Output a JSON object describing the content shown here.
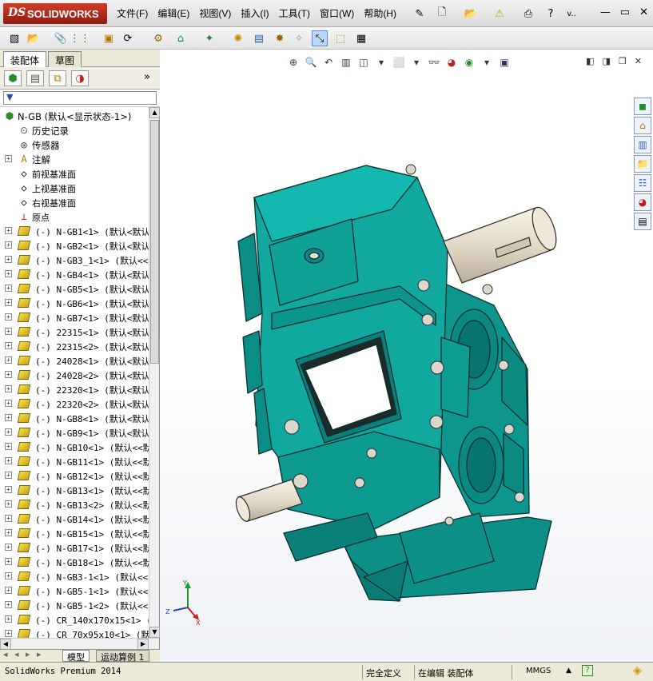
{
  "titlebar": {
    "logo_ds": "DS",
    "logo_text": "SOLIDWORKS",
    "menus": [
      "文件(F)",
      "编辑(E)",
      "视图(V)",
      "插入(I)",
      "工具(T)",
      "窗口(W)",
      "帮助(H)"
    ],
    "help_search_text": "v..",
    "window_controls": {
      "minimize": "—",
      "restore": "▭",
      "close": "✕"
    }
  },
  "panel": {
    "tabs": [
      "装配体",
      "草图"
    ],
    "more": "»",
    "tree": [
      {
        "label": "N-GB  (默认<显示状态-1>)",
        "kind": "root",
        "expand": ""
      },
      {
        "label": "历史记录",
        "kind": "feat",
        "icon": "history",
        "expand": ""
      },
      {
        "label": "传感器",
        "kind": "feat",
        "icon": "sensor",
        "expand": ""
      },
      {
        "label": "注解",
        "kind": "feat",
        "icon": "annotation",
        "expand": "+"
      },
      {
        "label": "前视基准面",
        "kind": "plane",
        "icon": "plane",
        "expand": ""
      },
      {
        "label": "上视基准面",
        "kind": "plane",
        "icon": "plane",
        "expand": ""
      },
      {
        "label": "右视基准面",
        "kind": "plane",
        "icon": "plane",
        "expand": ""
      },
      {
        "label": "原点",
        "kind": "origin",
        "icon": "origin",
        "expand": ""
      },
      {
        "label": "(-) N-GB1<1> (默认<默认",
        "kind": "part",
        "expand": "+"
      },
      {
        "label": "(-) N-GB2<1> (默认<默认",
        "kind": "part",
        "expand": "+"
      },
      {
        "label": "(-) N-GB3_1<1> (默认<<默",
        "kind": "part",
        "expand": "+"
      },
      {
        "label": "(-) N-GB4<1> (默认<默认",
        "kind": "part",
        "expand": "+"
      },
      {
        "label": "(-) N-GB5<1> (默认<默认",
        "kind": "part",
        "expand": "+"
      },
      {
        "label": "(-) N-GB6<1> (默认<默认",
        "kind": "part",
        "expand": "+"
      },
      {
        "label": "(-) N-GB7<1> (默认<默认",
        "kind": "part",
        "expand": "+"
      },
      {
        "label": "(-) 22315<1> (默认<默认",
        "kind": "part",
        "expand": "+"
      },
      {
        "label": "(-) 22315<2> (默认<默认",
        "kind": "part",
        "expand": "+"
      },
      {
        "label": "(-) 24028<1> (默认<默认",
        "kind": "part",
        "expand": "+"
      },
      {
        "label": "(-) 24028<2> (默认<默认",
        "kind": "part",
        "expand": "+"
      },
      {
        "label": "(-) 22320<1> (默认<默认",
        "kind": "part",
        "expand": "+"
      },
      {
        "label": "(-) 22320<2> (默认<默认",
        "kind": "part",
        "expand": "+"
      },
      {
        "label": "(-) N-GB8<1> (默认<默认",
        "kind": "part",
        "expand": "+"
      },
      {
        "label": "(-) N-GB9<1> (默认<默认",
        "kind": "part",
        "expand": "+"
      },
      {
        "label": "(-) N-GB10<1> (默认<<默",
        "kind": "part",
        "expand": "+"
      },
      {
        "label": "(-) N-GB11<1> (默认<<默",
        "kind": "part",
        "expand": "+"
      },
      {
        "label": "(-) N-GB12<1> (默认<<默",
        "kind": "part",
        "expand": "+"
      },
      {
        "label": "(-) N-GB13<1> (默认<<默",
        "kind": "part",
        "expand": "+"
      },
      {
        "label": "(-) N-GB13<2> (默认<<默",
        "kind": "part",
        "expand": "+"
      },
      {
        "label": "(-) N-GB14<1> (默认<<默",
        "kind": "part",
        "expand": "+"
      },
      {
        "label": "(-) N-GB15<1> (默认<<默",
        "kind": "part",
        "expand": "+"
      },
      {
        "label": "(-) N-GB17<1> (默认<<默",
        "kind": "part",
        "expand": "+"
      },
      {
        "label": "(-) N-GB18<1> (默认<<默",
        "kind": "part",
        "expand": "+"
      },
      {
        "label": "(-) N-GB3-1<1> (默认<<默",
        "kind": "part",
        "expand": "+"
      },
      {
        "label": "(-) N-GB5-1<1> (默认<<默",
        "kind": "part",
        "expand": "+"
      },
      {
        "label": "(-) N-GB5-1<2> (默认<<默",
        "kind": "part",
        "expand": "+"
      },
      {
        "label": "(-) CR_140x170x15<1> (默",
        "kind": "part",
        "expand": "+"
      },
      {
        "label": "(-) CR_70x95x10<1> (默认",
        "kind": "part",
        "expand": "+"
      }
    ],
    "bottom_tabs": [
      "模型",
      "运动算例 1"
    ]
  },
  "triad": {
    "x": "X",
    "y": "Y",
    "z": "Z"
  },
  "colors": {
    "model_teal": "#0fa39a",
    "model_edge": "#0a2f2d",
    "shaft": "#e8e0d2",
    "accent_red": "#c8281a"
  },
  "status": {
    "product": "SolidWorks Premium 2014",
    "state": "完全定义",
    "mode": "在编辑 装配体",
    "units": "MMGS"
  }
}
